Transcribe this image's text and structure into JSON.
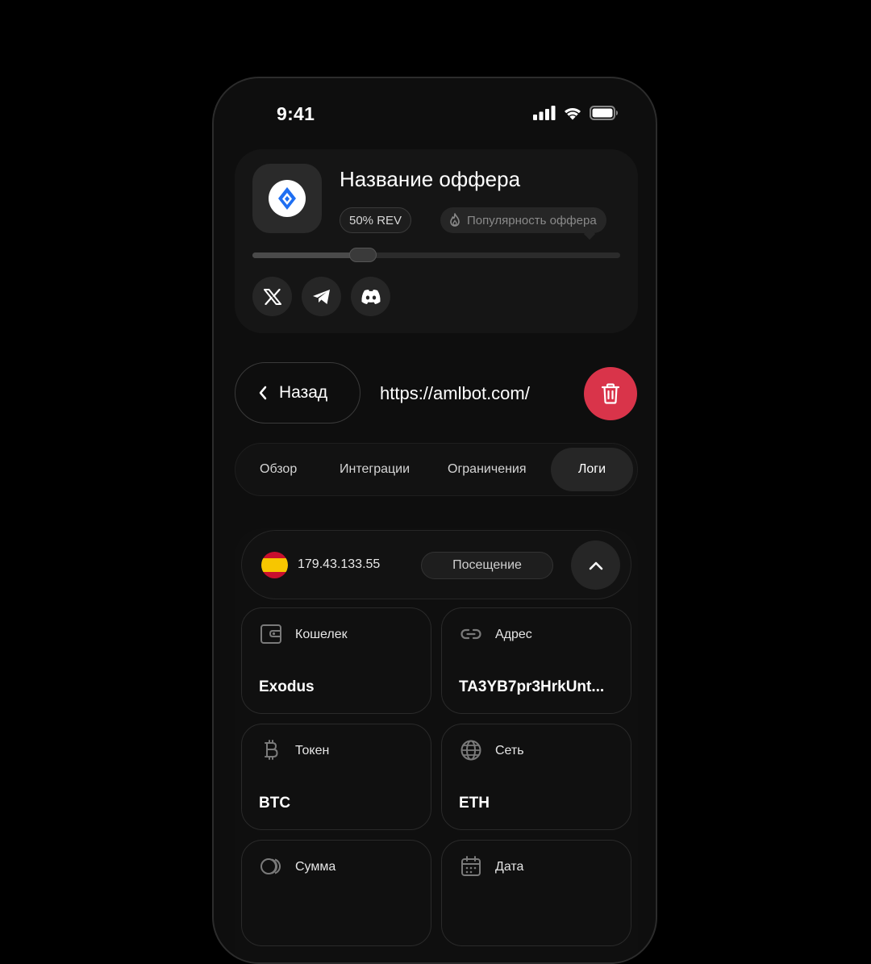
{
  "status": {
    "time": "9:41"
  },
  "offer": {
    "title": "Название оффера",
    "rev_badge": "50% REV",
    "popularity_label": "Популярность оффера",
    "popularity_level": 0.3
  },
  "socials": [
    "x-icon",
    "telegram-icon",
    "discord-icon"
  ],
  "nav": {
    "back_label": "Назад",
    "url": "https://amlbot.com/"
  },
  "tabs": [
    {
      "label": "Обзор",
      "active": false
    },
    {
      "label": "Интеграции",
      "active": false
    },
    {
      "label": "Ограничения",
      "active": false
    },
    {
      "label": "Логи",
      "active": true
    }
  ],
  "log": {
    "ip": "179.43.133.55",
    "event": "Посещение",
    "fields": [
      {
        "label": "Кошелек",
        "value": "Exodus",
        "icon": "wallet-icon"
      },
      {
        "label": "Адрес",
        "value": "TA3YB7pr3HrkUnt...",
        "icon": "link-icon"
      },
      {
        "label": "Токен",
        "value": "BTC",
        "icon": "bitcoin-icon"
      },
      {
        "label": "Сеть",
        "value": "ETH",
        "icon": "globe-icon"
      },
      {
        "label": "Сумма",
        "value": "",
        "icon": "coins-icon"
      },
      {
        "label": "Дата",
        "value": "",
        "icon": "calendar-icon"
      }
    ]
  },
  "colors": {
    "accent_delete": "#d9344a",
    "background": "#000000",
    "card": "#151515"
  }
}
